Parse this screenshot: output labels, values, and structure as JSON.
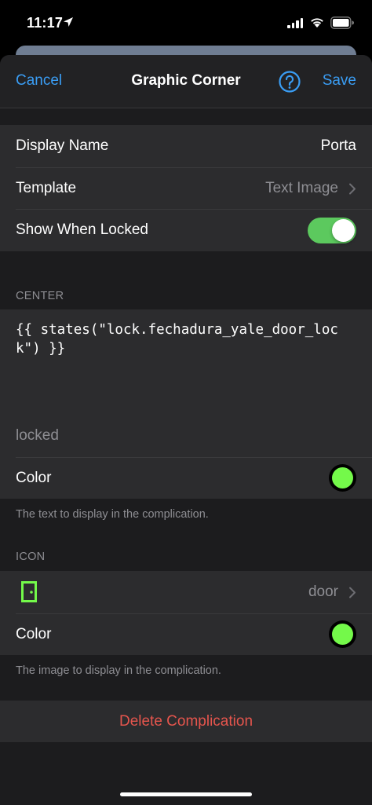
{
  "status": {
    "time": "11:17"
  },
  "nav": {
    "cancel": "Cancel",
    "title": "Graphic Corner",
    "save": "Save"
  },
  "general": {
    "display_name_label": "Display Name",
    "display_name_value": "Porta",
    "template_label": "Template",
    "template_value": "Text Image",
    "show_locked_label": "Show When Locked",
    "show_locked_on": true
  },
  "center": {
    "header": "CENTER",
    "template": "{{ states(\"lock.fechadura_yale_door_lock\") }}",
    "preview": "locked",
    "color_label": "Color",
    "color": "#74f94a",
    "footer": "The text to display in the complication."
  },
  "icon": {
    "header": "ICON",
    "icon_name": "door",
    "color_label": "Color",
    "color": "#74f94a",
    "footer": "The image to display in the complication."
  },
  "actions": {
    "delete": "Delete Complication"
  },
  "colors": {
    "accent": "#3a9df4",
    "destructive": "#e5554d",
    "toggle_on": "#5cc95e"
  }
}
